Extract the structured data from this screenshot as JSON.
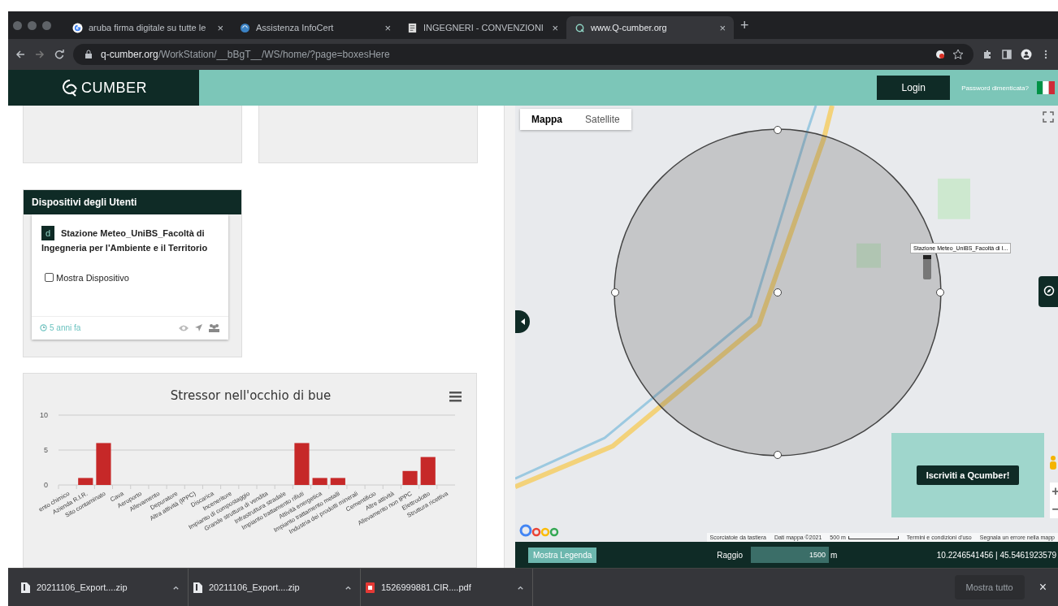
{
  "browser": {
    "tabs": [
      {
        "title": "aruba firma digitale su tutte le",
        "close": "×",
        "selected": false
      },
      {
        "title": "Assistenza InfoCert",
        "close": "×",
        "selected": false
      },
      {
        "title": "INGEGNERI - CONVENZIONI",
        "close": "×",
        "selected": false
      },
      {
        "title": "www.Q-cumber.org",
        "close": "×",
        "selected": true
      }
    ],
    "new_tab": "+",
    "address": {
      "domain": "q-cumber.org",
      "path": "/WorkStation/__bBgT__/WS/home/?page=boxesHere"
    }
  },
  "header": {
    "logo": "CUMBER",
    "login": "Login",
    "forgot_password": "Password dimenticata?"
  },
  "devices_panel": {
    "title": "Dispositivi degli Utenti",
    "device": {
      "badge": "d",
      "name": "Stazione Meteo_UniBS_Facoltà di Ingegneria per l'Ambiente e il Territorio",
      "show_label": "Mostra Dispositivo",
      "checked": false,
      "age": "5 anni fa"
    }
  },
  "chart_panel": {
    "chart_data": {
      "type": "bar",
      "title": "Stressor nell'occhio di bue",
      "categories": [
        "ento chimico",
        "Azienda R.I.R.",
        "Sito contaminato",
        "Cava",
        "Aeroporto",
        "Allevamento",
        "Depuratore",
        "Altra attività (IPPC)",
        "Discarica",
        "Inceneritore",
        "Impianto di compostaggio",
        "Grande struttura di vendita",
        "Infrastruttura stradale",
        "Impianto trattamento rifiuti",
        "Attività energetica",
        "Impianto trattamento metalli",
        "Industria dei prodotti minerali",
        "Cementificio",
        "Altre attività",
        "Allevamento non IPPC",
        "Elettrodotto",
        "Struttura ricettiva"
      ],
      "values": [
        0,
        1,
        6,
        0,
        0,
        0,
        0,
        0,
        0,
        0,
        0,
        0,
        0,
        6,
        1,
        1,
        0,
        0,
        0,
        2,
        4,
        0
      ],
      "ylim": [
        0,
        10
      ],
      "yticks": [
        0,
        5,
        10
      ]
    }
  },
  "map": {
    "map_types": [
      {
        "label": "Mappa",
        "selected": true
      },
      {
        "label": "Satellite",
        "selected": false
      }
    ],
    "marker_tooltip": "Stazione Meteo_UniBS_Facoltà di I...",
    "signup": "Iscriviti a Qcumber!",
    "zoom_in": "+",
    "zoom_out": "−",
    "footer": [
      "Scorciatoie da tastiera",
      "Dati mappa ©2021",
      "500 m",
      "Termini e condizioni d'uso",
      "Segnala un errore nella mapp"
    ],
    "legend_button": "Mostra Legenda",
    "radius_label": "Raggio",
    "radius_value": "1500",
    "radius_unit": "m",
    "coordinates": "10.2246541456 | 45.5461923579"
  },
  "downloads": {
    "items": [
      {
        "name": "20211106_Export....zip",
        "kind": "zip"
      },
      {
        "name": "20211106_Export....zip",
        "kind": "zip"
      },
      {
        "name": "1526999881.CIR....pdf",
        "kind": "pdf"
      }
    ],
    "show_all": "Mostra tutto",
    "close": "×"
  }
}
